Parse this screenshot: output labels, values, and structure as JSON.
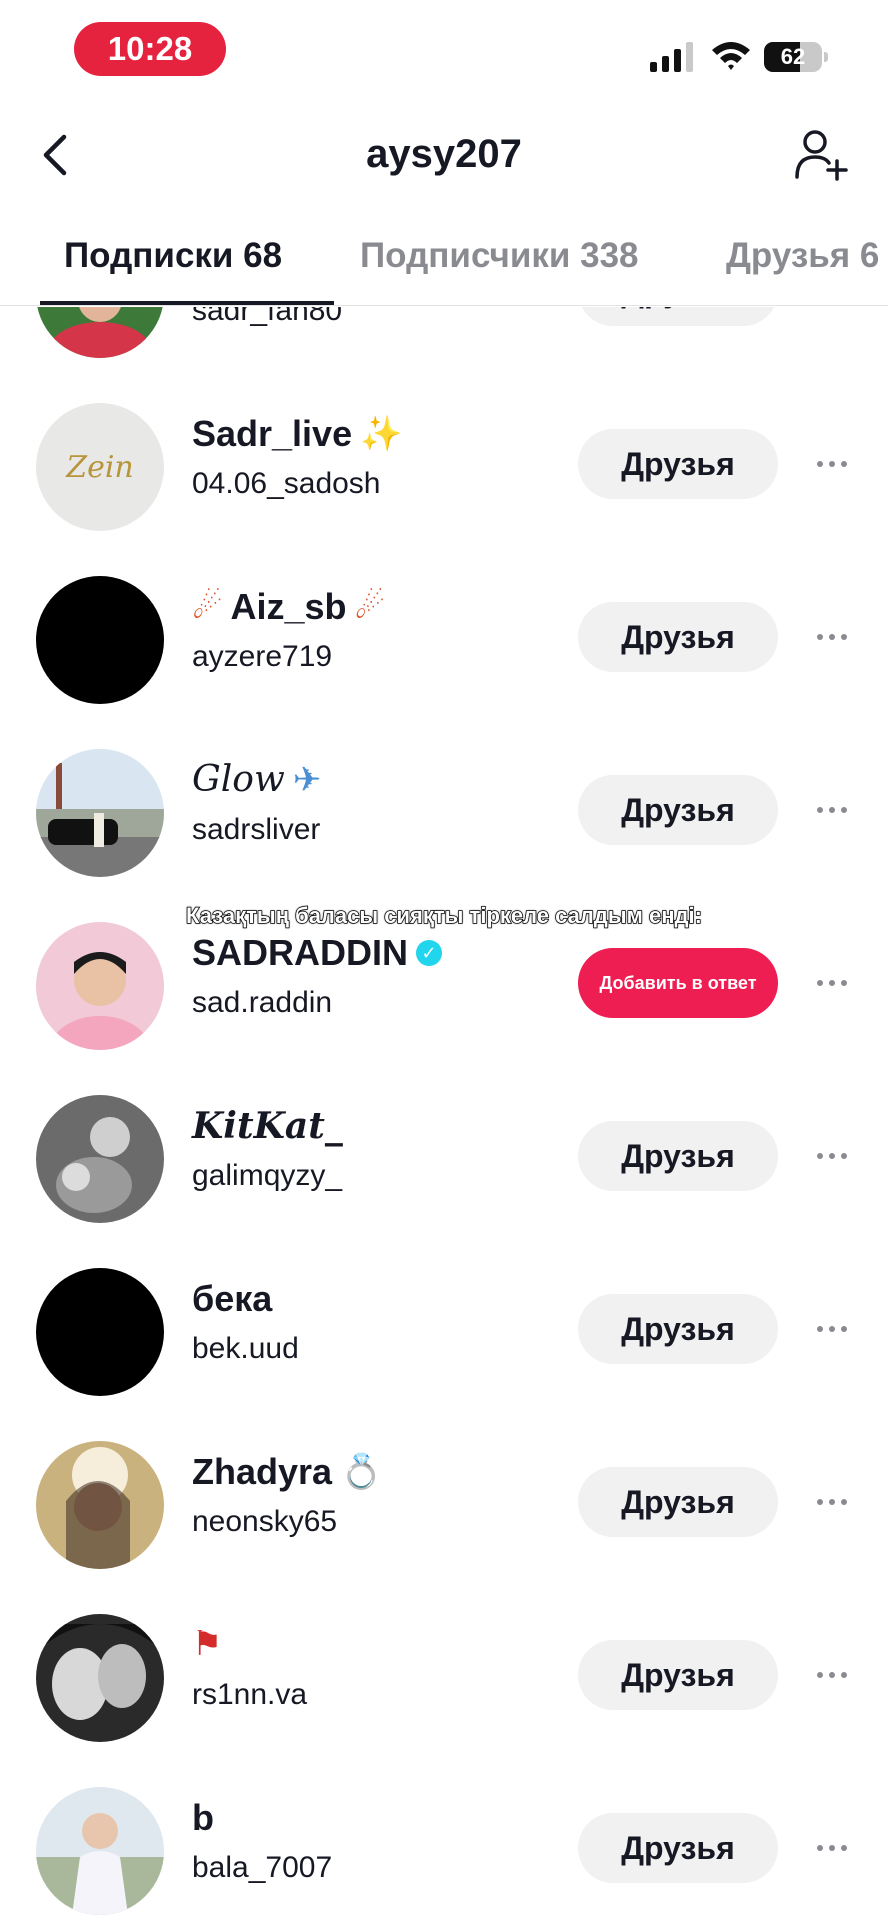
{
  "status_bar": {
    "time": "10:28",
    "battery": "62",
    "battery_level": 0.62
  },
  "header": {
    "title": "aysy207",
    "back_icon": "chevron-left-icon",
    "add_icon": "add-user-icon"
  },
  "tabs": [
    {
      "label": "Подписки 68",
      "active": true
    },
    {
      "label": "Подписчики 338",
      "active": false
    },
    {
      "label": "Друзья 6",
      "active": false
    }
  ],
  "caption": "Казақтың баласы сияқты тіркеле салдым енді:",
  "rows": [
    {
      "name": "",
      "handle": "sadr_fan80",
      "button": "Друзья"
    },
    {
      "name": "Sadr_live",
      "name_emoji": "✨",
      "handle": "04.06_sadosh",
      "button": "Друзья"
    },
    {
      "name": "Aiz_sb",
      "name_emoji_pre": "☄",
      "name_emoji": "☄",
      "handle": "ayzere719",
      "button": "Друзья"
    },
    {
      "name": "Glow",
      "name_emoji": "✈",
      "handle": "sadrsliver",
      "button": "Друзья"
    },
    {
      "name": "SADRADDIN",
      "verified": true,
      "handle": "sad.raddin",
      "button": "Добавить в ответ"
    },
    {
      "name": "KitKat_",
      "handle": "galimqyzy_",
      "button": "Друзья"
    },
    {
      "name": "бека",
      "handle": "bek.uud",
      "button": "Друзья"
    },
    {
      "name": "Zhadyra",
      "name_emoji": "💍",
      "handle": "neonsky65",
      "button": "Друзья"
    },
    {
      "name": "",
      "name_emoji": "⚑",
      "handle": "rs1nn.va",
      "button": "Друзья"
    },
    {
      "name": "b",
      "handle": "bala_7007",
      "button": "Друзья"
    }
  ],
  "colors": {
    "accent": "#ee1d52",
    "status_pill": "#e5233e",
    "verified": "#20d5ec",
    "button_bg": "#f1f1f2"
  }
}
